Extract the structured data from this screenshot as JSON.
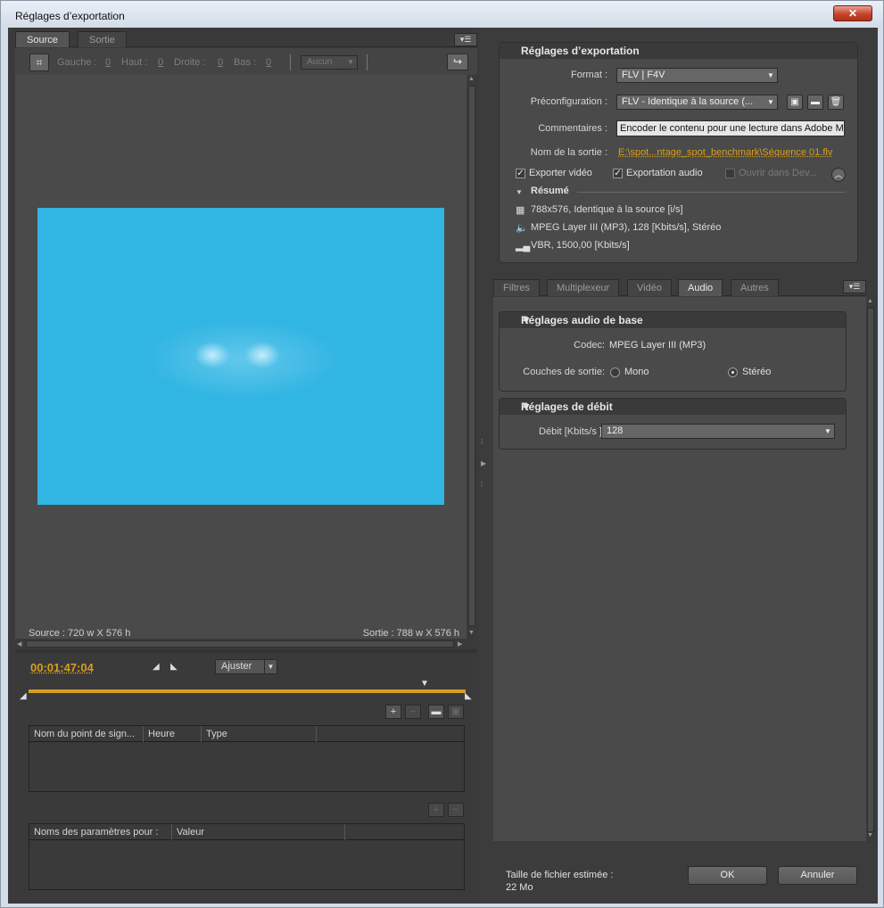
{
  "window": {
    "title": "Réglages d’exportation",
    "close_glyph": "✕"
  },
  "left": {
    "tabs": [
      "Source",
      "Sortie"
    ],
    "crop": {
      "left_label": "Gauche :",
      "left_value": "0",
      "top_label": "Haut :",
      "top_value": "0",
      "right_label": "Droite :",
      "right_value": "0",
      "bottom_label": "Bas :",
      "bottom_value": "0",
      "ratio_value": "Aucun"
    },
    "source_info": "Source : 720 w X 576 h",
    "output_info": "Sortie : 788 w X 576 h",
    "timecode": "00:01:47:04",
    "fit_value": "Ajuster",
    "cue_grid": {
      "columns": [
        "Nom du point de sign...",
        "Heure",
        "Type"
      ]
    },
    "param_grid": {
      "columns": [
        "Noms des paramètres pour :",
        "Valeur"
      ]
    }
  },
  "export": {
    "header": "Réglages d’exportation",
    "format_label": "Format :",
    "format_value": "FLV | F4V",
    "preset_label": "Préconfiguration :",
    "preset_value": "FLV - Identique à la source (...",
    "comments_label": "Commentaires :",
    "comments_value": "Encoder le contenu pour une lecture dans Adobe Me",
    "output_label": "Nom de la sortie :",
    "output_value": "E:\\spot...ntage_spot_benchmark\\Séquence 01.flv",
    "export_video_label": "Exporter vidéo",
    "export_video_checked": true,
    "export_audio_label": "Exportation audio",
    "export_audio_checked": true,
    "open_in_dev_label": "Ouvrir dans Dev...",
    "open_in_dev_checked": false,
    "summary_label": "Résumé",
    "summary": [
      "788x576, Identique à la source [i/s]",
      "MPEG Layer III (MP3), 128 [Kbits/s], Stéréo",
      "VBR, 1500,00 [Kbits/s]"
    ]
  },
  "settings_tabs": [
    "Filtres",
    "Multiplexeur",
    "Vidéo",
    "Audio",
    "Autres"
  ],
  "settings_active_tab": "Audio",
  "audio": {
    "basic_header": "Réglages audio de base",
    "codec_label": "Codec:",
    "codec_value": "MPEG Layer III (MP3)",
    "channels_label": "Couches de sortie:",
    "mono_label": "Mono",
    "stereo_label": "Stéréo",
    "selected_channel": "Stéréo",
    "bitrate_header": "Réglages de débit",
    "bitrate_label": "Débit [Kbits/s ]:",
    "bitrate_value": "128"
  },
  "footer": {
    "estimate_label": "Taille de fichier estimée :",
    "estimate_value": "22 Mo",
    "ok_label": "OK",
    "cancel_label": "Annuler"
  },
  "colors": {
    "accent": "#d69e1e",
    "video_bg": "#31b5e3",
    "panel": "#4a4a4a"
  }
}
